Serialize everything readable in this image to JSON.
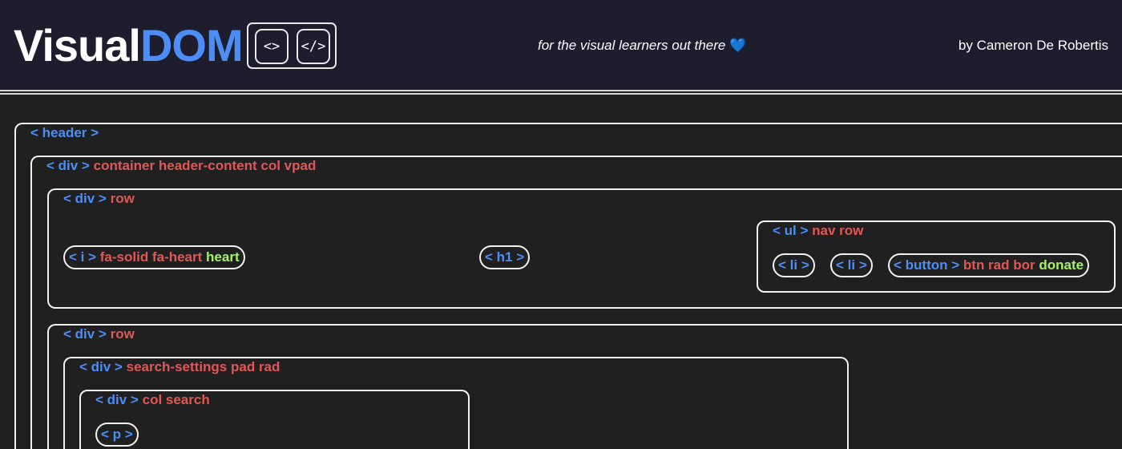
{
  "app": {
    "brand_part1": "Visual",
    "brand_part2": "DOM",
    "logo_icon_1": "<>",
    "logo_icon_2": "</>",
    "tagline": "for the visual learners out there",
    "tagline_icon": "blue-heart-icon",
    "byline": "by Cameron De Robertis"
  },
  "colors": {
    "tag": "#4c8df6",
    "class": "#e05757",
    "text": "#a6f067",
    "border": "#f2f2f2",
    "header_bg": "#1d1d2e",
    "page_bg": "#202020"
  },
  "tree": {
    "header": {
      "tag": "< header >"
    },
    "container": {
      "tag": "< div >",
      "classes": "container header-content col vpad"
    },
    "row1": {
      "tag": "< div >",
      "classes": "row"
    },
    "i_node": {
      "tag": "< i >",
      "classes": "fa-solid fa-heart",
      "text": "heart"
    },
    "h1_node": {
      "tag": "< h1 >"
    },
    "ul_node": {
      "tag": "< ul >",
      "classes": "nav row"
    },
    "li_1": {
      "tag": "< li >"
    },
    "li_2": {
      "tag": "< li >"
    },
    "button_node": {
      "tag": "< button >",
      "classes": "btn rad bor",
      "text": "donate"
    },
    "row2": {
      "tag": "< div >",
      "classes": "row"
    },
    "search_settings": {
      "tag": "< div >",
      "classes": "search-settings pad rad"
    },
    "col_search": {
      "tag": "< div >",
      "classes": "col search"
    },
    "p_node": {
      "tag": "< p >"
    }
  }
}
